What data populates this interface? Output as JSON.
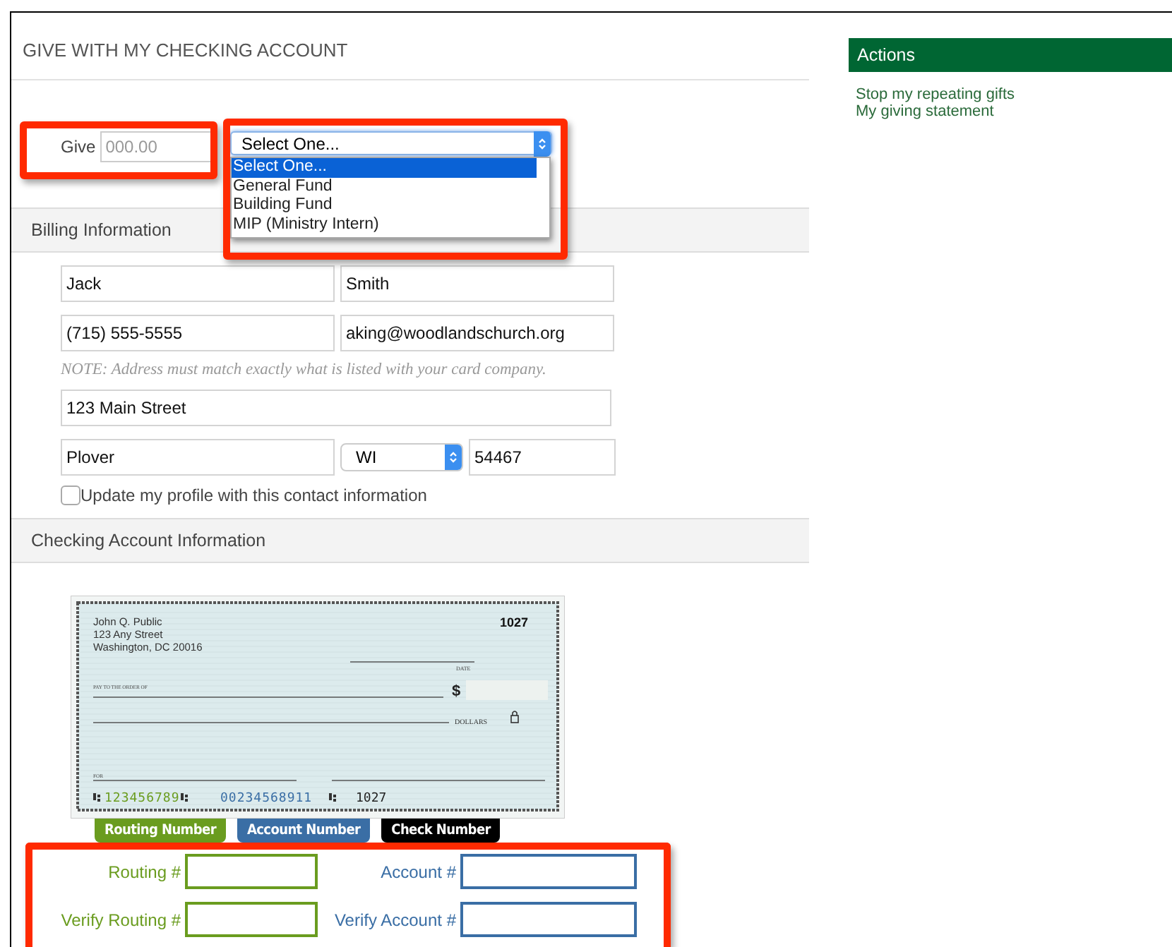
{
  "page": {
    "title": "GIVE WITH MY CHECKING ACCOUNT"
  },
  "give": {
    "label": "Give",
    "amount": {
      "placeholder": "000.00"
    },
    "fund_select": {
      "value": "Select One...",
      "expanded": true,
      "options": [
        {
          "label": "Select One...",
          "selected": true
        },
        {
          "label": "General Fund",
          "selected": false
        },
        {
          "label": "Building Fund",
          "selected": false
        },
        {
          "label": "MIP (Ministry Intern)",
          "selected": false
        }
      ]
    }
  },
  "billing": {
    "heading": "Billing Information",
    "first_name": {
      "value": "Jack"
    },
    "last_name": {
      "value": "Smith"
    },
    "phone": {
      "value": "(715) 555-5555"
    },
    "email": {
      "value": "aking@woodlandschurch.org"
    },
    "note": "NOTE: Address must match exactly what is listed with your card company.",
    "address": {
      "value": "123 Main Street"
    },
    "city": {
      "value": "Plover"
    },
    "state": {
      "value": "WI"
    },
    "zip": {
      "value": "54467"
    },
    "update_profile": {
      "label": "Update my profile with this contact information",
      "checked": false
    }
  },
  "checking": {
    "heading": "Checking Account Information",
    "check": {
      "owner_lines": [
        "John Q. Public",
        "123 Any Street",
        "Washington, DC 20016"
      ],
      "number": "1027",
      "date_label": "DATE",
      "payee_label": "PAY TO THE ORDER OF",
      "currency": "$",
      "dollars_label": "DOLLARS",
      "memo_label": "FOR",
      "routing": "123456789",
      "account": "00234568911",
      "check_no": "1027"
    },
    "tags": [
      {
        "label": "Routing Number",
        "color": "#6a9c1f"
      },
      {
        "label": "Account Number",
        "color": "#3a6ea5"
      },
      {
        "label": "Check Number",
        "color": "#000000"
      }
    ],
    "fields": [
      {
        "label": "Routing #",
        "color": "#6a9c1f"
      },
      {
        "label": "Account #",
        "color": "#3a6ea5"
      },
      {
        "label": "Verify Routing #",
        "color": "#6a9c1f"
      },
      {
        "label": "Verify Account #",
        "color": "#3a6ea5"
      }
    ]
  },
  "sidebar": {
    "title": "Actions",
    "links": [
      "Stop my repeating gifts",
      "My giving statement"
    ]
  }
}
